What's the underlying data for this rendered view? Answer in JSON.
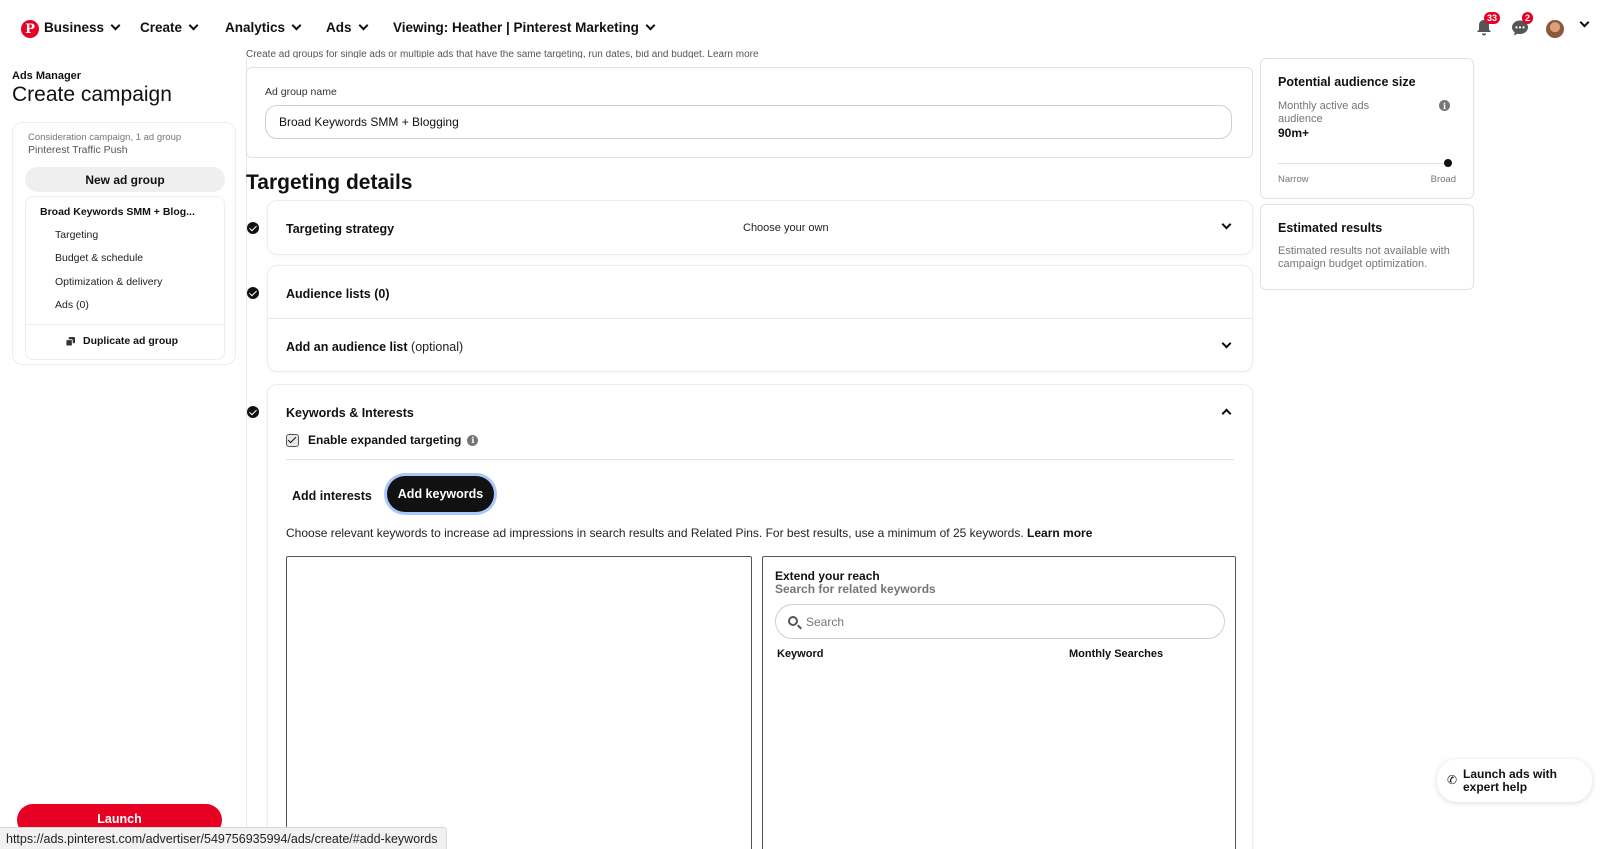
{
  "nav": {
    "business": "Business",
    "create": "Create",
    "analytics": "Analytics",
    "ads": "Ads",
    "viewing": "Viewing: Heather | Pinterest Marketing",
    "notifications_count": "33",
    "messages_count": "2"
  },
  "sidebar": {
    "small_label": "Ads Manager",
    "title": "Create campaign",
    "campaign_meta": "Consideration campaign, 1 ad group",
    "campaign_name": "Pinterest Traffic Push",
    "new_ad_group": "New ad group",
    "ad_group_name": "Broad Keywords SMM + Blog...",
    "items": [
      {
        "label": "Targeting"
      },
      {
        "label": "Budget & schedule"
      },
      {
        "label": "Optimization & delivery"
      },
      {
        "label": "Ads (0)"
      }
    ],
    "duplicate": "Duplicate ad group",
    "launch": "Launch"
  },
  "main": {
    "cutoff_text": "Create ad groups for single ads or multiple ads that have the same targeting, run dates, bid and budget. Learn more",
    "ad_group_name_label": "Ad group name",
    "ad_group_name_value": "Broad Keywords SMM + Blogging",
    "targeting_title": "Targeting details",
    "sections": {
      "strategy": {
        "title": "Targeting strategy",
        "value": "Choose your own"
      },
      "audience_lists": {
        "title": "Audience lists (0)"
      },
      "add_audience": {
        "title": "Add an audience list",
        "optional": "(optional)"
      },
      "keywords": {
        "title": "Keywords & Interests",
        "expanded_label": "Enable expanded targeting",
        "expanded_checked": true,
        "tab_interests": "Add interests",
        "tab_keywords": "Add keywords",
        "description": "Choose relevant keywords to increase ad impressions in search results and Related Pins. For best results, use a minimum of 25 keywords.",
        "learn_more": "Learn more",
        "extend_title": "Extend your reach",
        "extend_sub": "Search for related keywords",
        "search_placeholder": "Search",
        "col_keyword": "Keyword",
        "col_monthly": "Monthly Searches"
      }
    }
  },
  "right_panel": {
    "audience_title": "Potential audience size",
    "audience_desc": "Monthly active ads audience",
    "audience_value": "90m+",
    "slider_level": 1.0,
    "narrow": "Narrow",
    "broad": "Broad",
    "results_title": "Estimated results",
    "results_desc": "Estimated results not available with campaign budget optimization."
  },
  "expert_help": "Launch ads with expert help",
  "status_url": "https://ads.pinterest.com/advertiser/549756935994/ads/create/#add-keywords",
  "colors": {
    "brand": "#e60023",
    "focus_ring": "#a8c7fa"
  }
}
